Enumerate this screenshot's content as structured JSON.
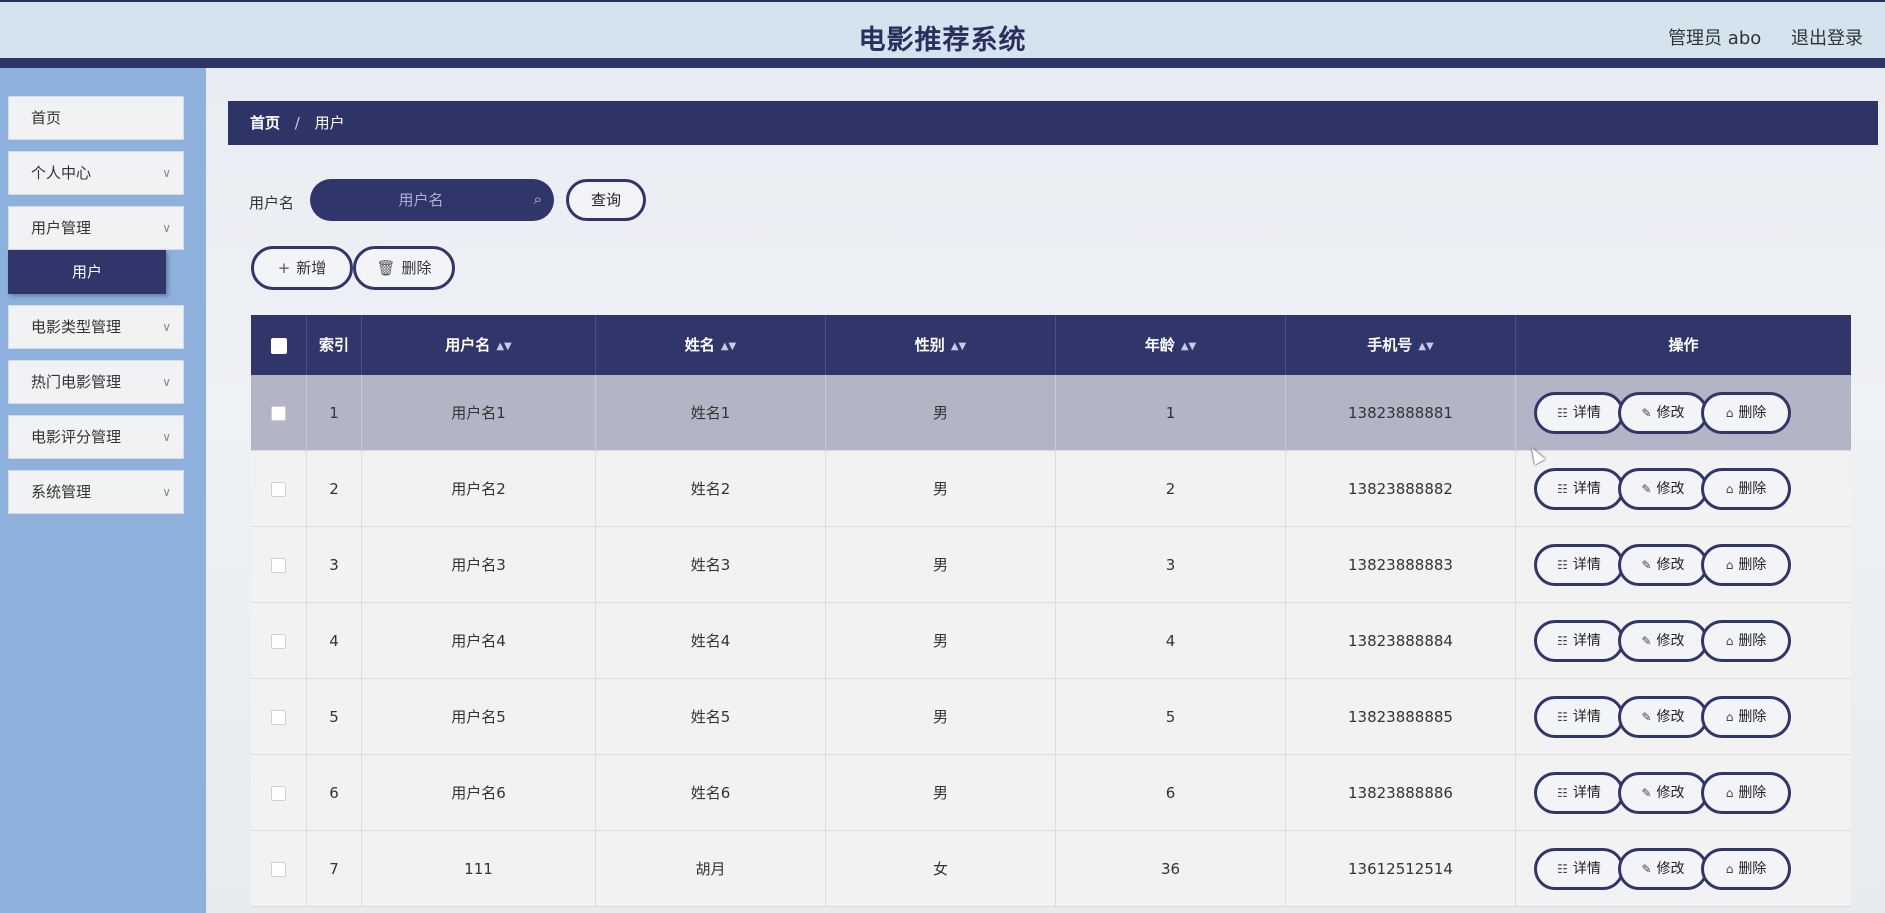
{
  "header": {
    "title": "电影推荐系统",
    "user_label": "管理员 abo",
    "logout_label": "退出登录"
  },
  "sidebar": {
    "items": [
      {
        "label": "首页"
      },
      {
        "label": "个人中心"
      },
      {
        "label": "用户管理"
      },
      {
        "label": "用户"
      },
      {
        "label": "电影类型管理"
      },
      {
        "label": "热门电影管理"
      },
      {
        "label": "电影评分管理"
      },
      {
        "label": "系统管理"
      }
    ]
  },
  "breadcrumb": {
    "home": "首页",
    "separator": "/",
    "current": "用户"
  },
  "search": {
    "label": "用户名",
    "placeholder": "用户名",
    "button": "查询"
  },
  "toolbar": {
    "add_label": "新增",
    "delete_label": "删除"
  },
  "table": {
    "columns": [
      "索引",
      "用户名",
      "姓名",
      "性别",
      "年龄",
      "手机号",
      "操作"
    ],
    "rows": [
      {
        "index": "1",
        "username": "用户名1",
        "name": "姓名1",
        "gender": "男",
        "age": "1",
        "phone": "13823888881"
      },
      {
        "index": "2",
        "username": "用户名2",
        "name": "姓名2",
        "gender": "男",
        "age": "2",
        "phone": "13823888882"
      },
      {
        "index": "3",
        "username": "用户名3",
        "name": "姓名3",
        "gender": "男",
        "age": "3",
        "phone": "13823888883"
      },
      {
        "index": "4",
        "username": "用户名4",
        "name": "姓名4",
        "gender": "男",
        "age": "4",
        "phone": "13823888884"
      },
      {
        "index": "5",
        "username": "用户名5",
        "name": "姓名5",
        "gender": "男",
        "age": "5",
        "phone": "13823888885"
      },
      {
        "index": "6",
        "username": "用户名6",
        "name": "姓名6",
        "gender": "男",
        "age": "6",
        "phone": "13823888886"
      },
      {
        "index": "7",
        "username": "111",
        "name": "胡月",
        "gender": "女",
        "age": "36",
        "phone": "13612512514"
      }
    ],
    "actions": {
      "detail": "详情",
      "edit": "修改",
      "delete": "删除"
    }
  },
  "colors": {
    "primary": "#30356a",
    "sidebar_bg": "#8db1dc",
    "header_bg": "#d3e4ef",
    "row_highlight": "#b3b5c6"
  }
}
